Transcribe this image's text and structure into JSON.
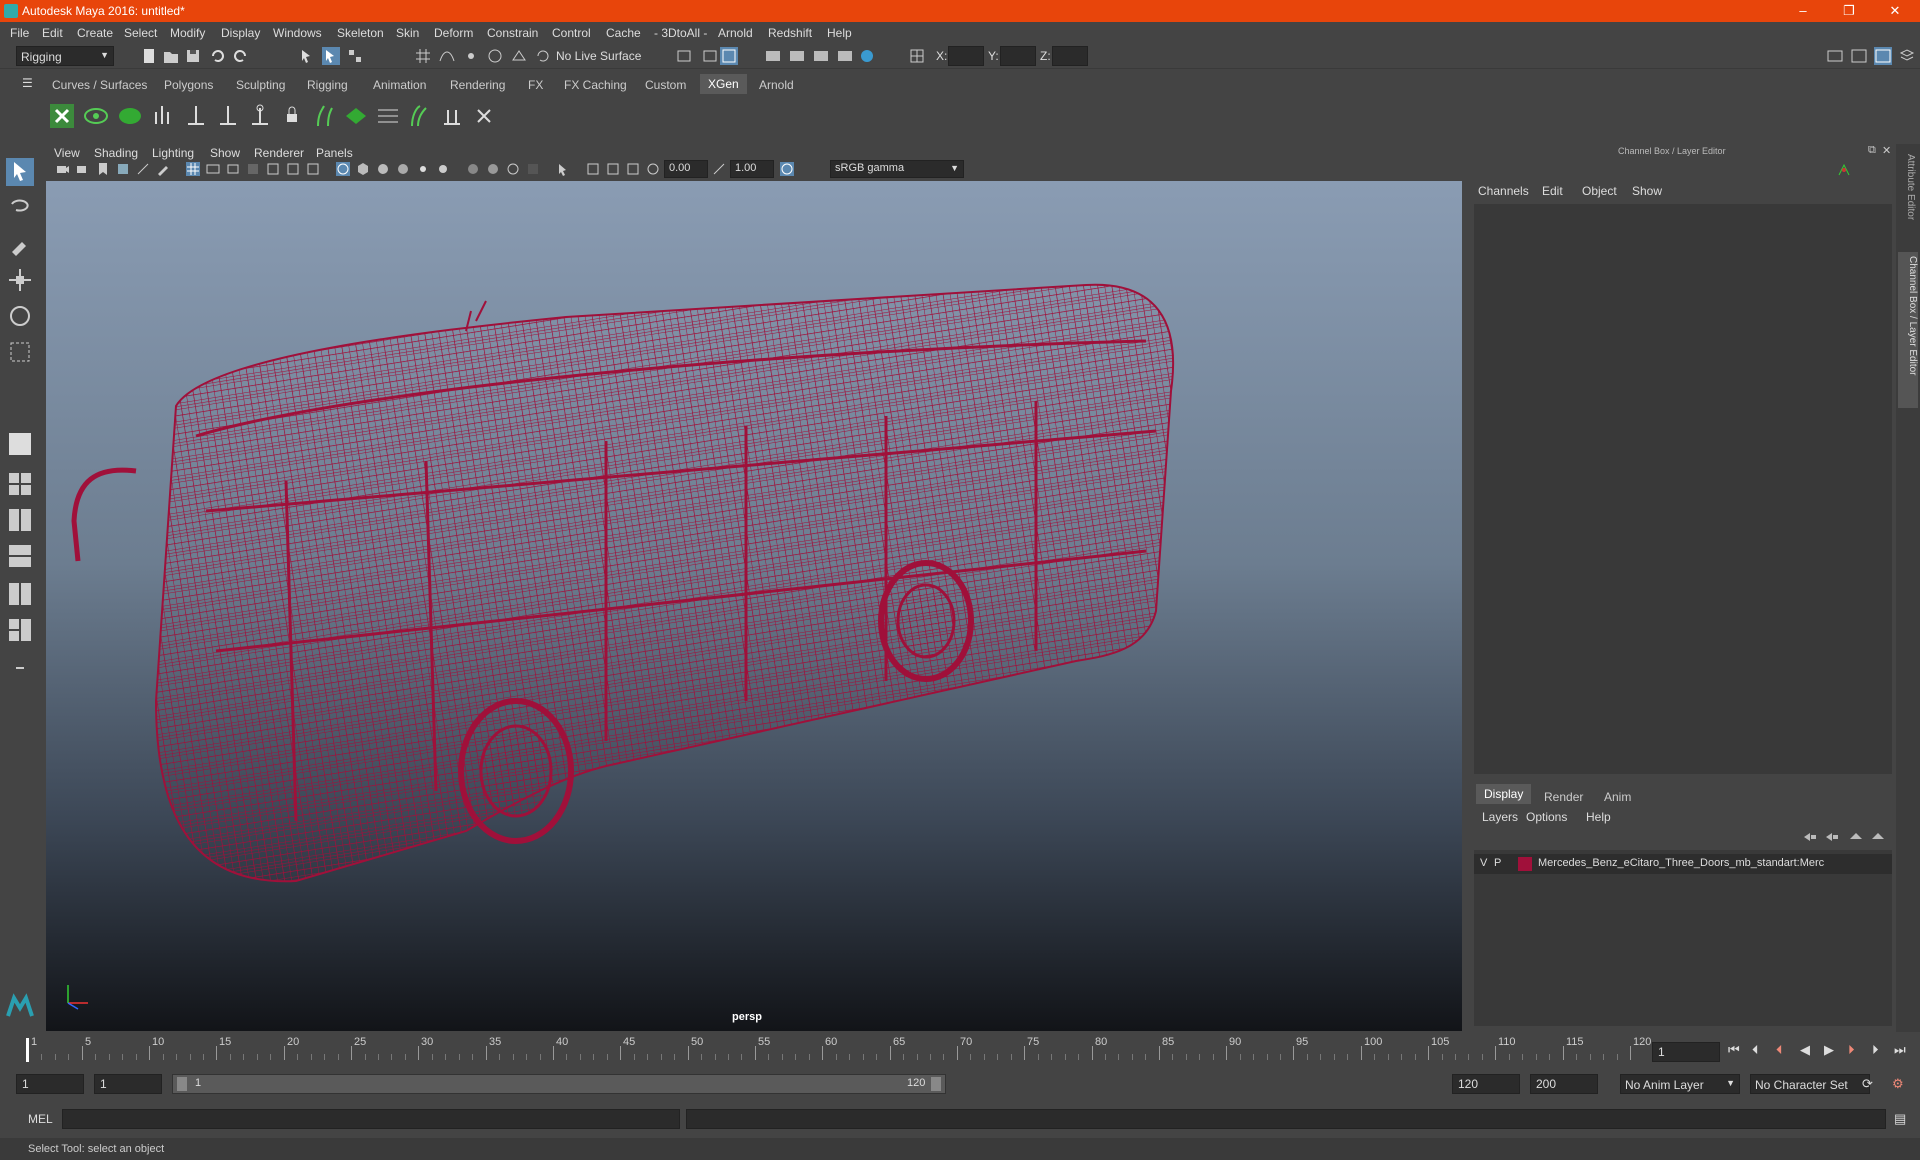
{
  "window": {
    "title": "Autodesk Maya 2016: untitled*",
    "controls": [
      "–",
      "❐",
      "✕"
    ]
  },
  "menu": [
    "File",
    "Edit",
    "Create",
    "Select",
    "Modify",
    "Display",
    "Windows",
    "Skeleton",
    "Skin",
    "Deform",
    "Constrain",
    "Control",
    "Cache",
    "- 3DtoAll -",
    "Arnold",
    "Redshift",
    "Help"
  ],
  "statusline": {
    "menuset": "Rigging",
    "live_surface": "No Live Surface",
    "x_label": "X:",
    "y_label": "Y:",
    "z_label": "Z:"
  },
  "shelf_tabs": [
    "Curves / Surfaces",
    "Polygons",
    "Sculpting",
    "Rigging",
    "Animation",
    "Rendering",
    "FX",
    "FX Caching",
    "Custom",
    "XGen",
    "Arnold"
  ],
  "active_shelf": "XGen",
  "panel_menu": [
    "View",
    "Shading",
    "Lighting",
    "Show",
    "Renderer",
    "Panels"
  ],
  "panel_toolbar": {
    "exposure": "0.00",
    "gamma": "1.00",
    "colorspace": "sRGB gamma"
  },
  "viewport": {
    "camera_label": "persp",
    "wire_color": "#a0103a"
  },
  "channel_box": {
    "title": "Channel Box / Layer Editor",
    "menu": [
      "Channels",
      "Edit",
      "Object",
      "Show"
    ],
    "layer_tabs": [
      "Display",
      "Render",
      "Anim"
    ],
    "active_layer_tab": "Display",
    "layer_menu": [
      "Layers",
      "Options",
      "Help"
    ],
    "layers": [
      {
        "v": "V",
        "p": "P",
        "color": "#a0103a",
        "name": "Mercedes_Benz_eCitaro_Three_Doors_mb_standart:Merc"
      }
    ]
  },
  "side_tabs": [
    "Attribute Editor",
    "Channel Box / Layer Editor"
  ],
  "timeline": {
    "ticks": [
      "1",
      "5",
      "10",
      "15",
      "20",
      "25",
      "30",
      "35",
      "40",
      "45",
      "50",
      "55",
      "60",
      "65",
      "70",
      "75",
      "80",
      "85",
      "90",
      "95",
      "100",
      "105",
      "110",
      "115",
      "120"
    ],
    "current_frame": "1"
  },
  "range": {
    "start": "1",
    "playback_start": "1",
    "slider_start": "1",
    "slider_end": "120",
    "playback_end": "120",
    "end": "200",
    "anim_layer": "No Anim Layer",
    "character_set": "No Character Set"
  },
  "command": {
    "lang": "MEL"
  },
  "help_line": "Select Tool: select an object"
}
